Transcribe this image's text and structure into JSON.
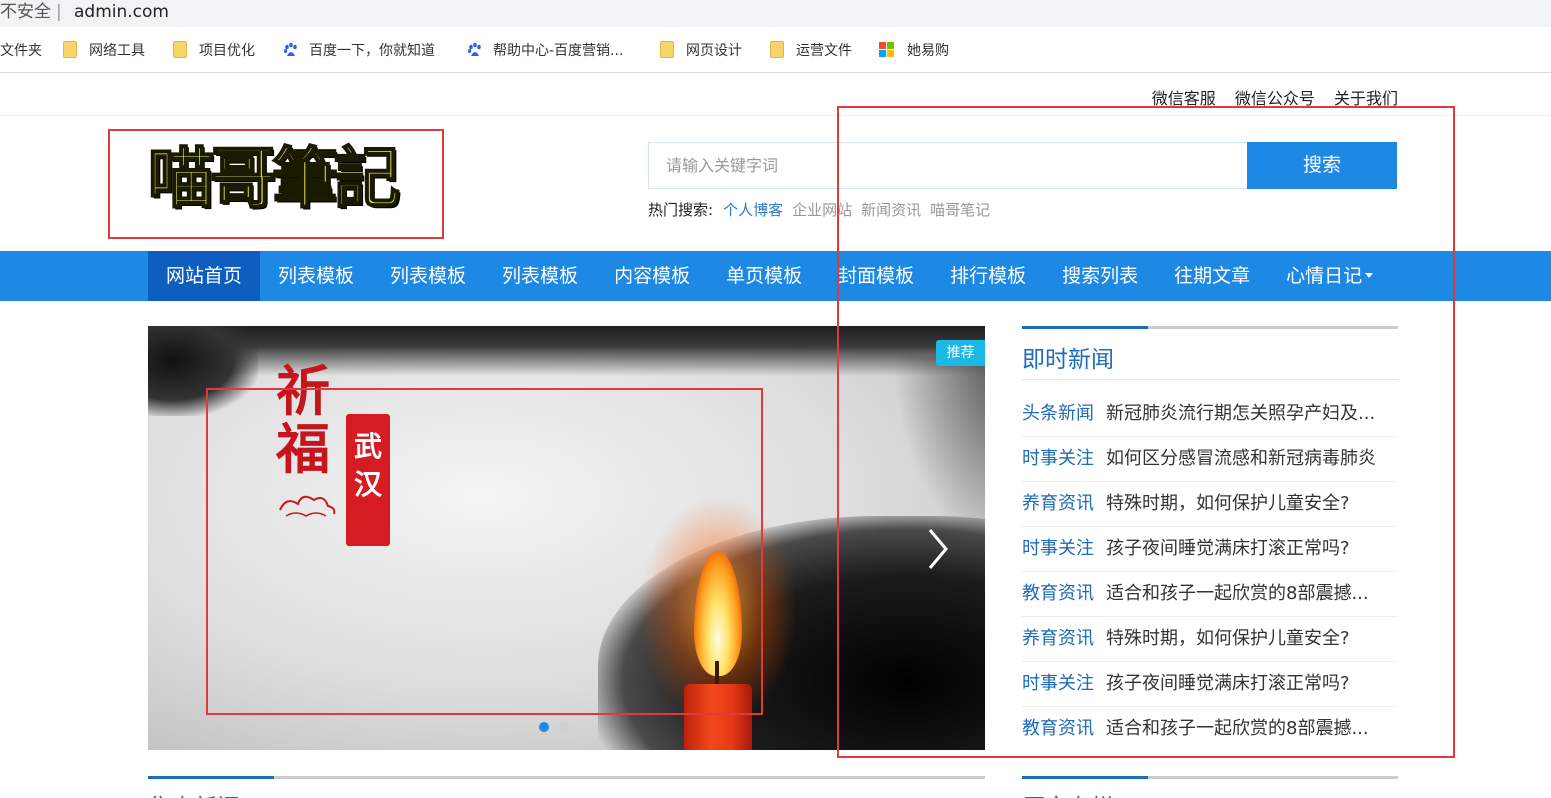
{
  "browser": {
    "security_label": "不安全",
    "separator": "|",
    "url": "admin.com",
    "bookmarks": [
      {
        "label": "文件夹",
        "icon": "folder-icon"
      },
      {
        "label": "网络工具",
        "icon": "folder-icon"
      },
      {
        "label": "项目优化",
        "icon": "folder-icon"
      },
      {
        "label": "百度一下，你就知道",
        "icon": "baidu-paw-icon"
      },
      {
        "label": "帮助中心-百度营销...",
        "icon": "baidu-paw-icon"
      },
      {
        "label": "网页设计",
        "icon": "folder-icon"
      },
      {
        "label": "运营文件",
        "icon": "folder-icon"
      },
      {
        "label": "她易购",
        "icon": "colored-squares-icon"
      }
    ]
  },
  "topbar": {
    "links": [
      "微信客服",
      "微信公众号",
      "关于我们"
    ]
  },
  "logo": {
    "text": "喵哥筆記"
  },
  "search": {
    "placeholder": "请输入关键字词",
    "button": "搜索",
    "hot_label": "热门搜索:",
    "hot_terms": [
      "个人博客",
      "企业网站",
      "新闻资讯",
      "喵哥笔记"
    ]
  },
  "nav": {
    "items": [
      "网站首页",
      "列表模板",
      "列表模板",
      "列表模板",
      "内容模板",
      "单页模板",
      "封面模板",
      "排行模板",
      "搜索列表",
      "往期文章",
      "心情日记"
    ],
    "active_index": 0
  },
  "banner": {
    "tag": "推荐",
    "qifu": "祈福",
    "seal": "武汉",
    "slide_count": 2,
    "active_slide": 0
  },
  "news": {
    "title": "即时新闻",
    "items": [
      {
        "category": "头条新闻",
        "title": "新冠肺炎流行期怎关照孕产妇及..."
      },
      {
        "category": "时事关注",
        "title": "如何区分感冒流感和新冠病毒肺炎"
      },
      {
        "category": "养育资讯",
        "title": "特殊时期，如何保护儿童安全?"
      },
      {
        "category": "时事关注",
        "title": "孩子夜间睡觉满床打滚正常吗?"
      },
      {
        "category": "教育资讯",
        "title": "适合和孩子一起欣赏的8部震撼..."
      },
      {
        "category": "养育资讯",
        "title": "特殊时期，如何保护儿童安全?"
      },
      {
        "category": "时事关注",
        "title": "孩子夜间睡觉满床打滚正常吗?"
      },
      {
        "category": "教育资讯",
        "title": "适合和孩子一起欣赏的8部震撼..."
      }
    ]
  },
  "sections": {
    "left_title": "焦点新闻",
    "right_title": "原文专栏"
  },
  "colors": {
    "brand_blue": "#1e88e5",
    "nav_active": "#0d5ebf",
    "link_blue": "#1e6bb8",
    "tag_cyan": "#1cb9e6",
    "annotation_red": "#e03a3a"
  }
}
